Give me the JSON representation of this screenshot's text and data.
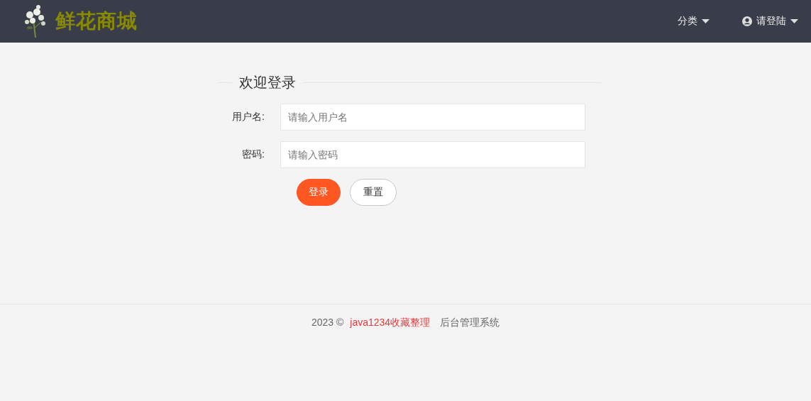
{
  "header": {
    "brand": "鲜花商城",
    "nav": [
      {
        "label": "分类",
        "kind": "dropdown"
      },
      {
        "label": "请登陆",
        "kind": "user"
      }
    ]
  },
  "login": {
    "title": "欢迎登录",
    "fields": [
      {
        "label": "用户名:",
        "placeholder": "请输入用户名"
      },
      {
        "label": "密码:",
        "placeholder": "请输入密码"
      }
    ],
    "buttons": [
      {
        "label": "登录",
        "kind": "primary"
      },
      {
        "label": "重置",
        "kind": "secondary"
      }
    ]
  },
  "footer": {
    "copyright": "2023 ©",
    "link": "java1234收藏整理",
    "system": "后台管理系统"
  }
}
